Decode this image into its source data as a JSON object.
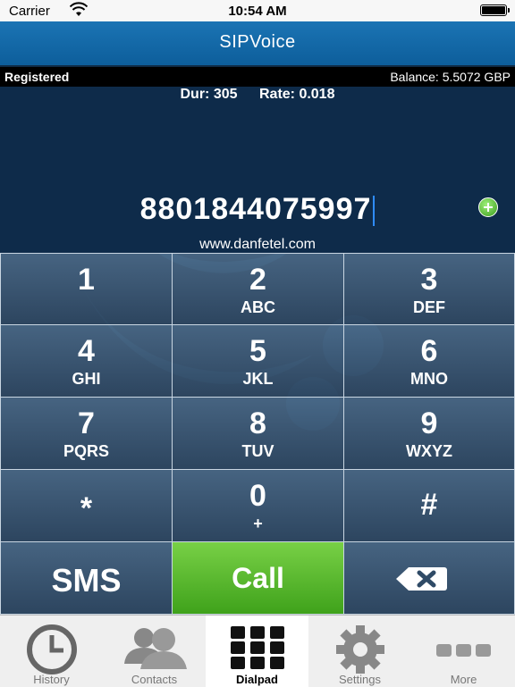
{
  "status_bar": {
    "carrier": "Carrier",
    "time": "10:54 AM"
  },
  "nav": {
    "title": "SIPVoice"
  },
  "info": {
    "registration": "Registered",
    "balance": "Balance: 5.5072 GBP"
  },
  "call_info": {
    "duration": "Dur: 305",
    "rate": "Rate: 0.018"
  },
  "dial": {
    "number": "8801844075997",
    "website": "www.danfetel.com"
  },
  "keys": [
    {
      "digit": "1",
      "letters": ""
    },
    {
      "digit": "2",
      "letters": "ABC"
    },
    {
      "digit": "3",
      "letters": "DEF"
    },
    {
      "digit": "4",
      "letters": "GHI"
    },
    {
      "digit": "5",
      "letters": "JKL"
    },
    {
      "digit": "6",
      "letters": "MNO"
    },
    {
      "digit": "7",
      "letters": "PQRS"
    },
    {
      "digit": "8",
      "letters": "TUV"
    },
    {
      "digit": "9",
      "letters": "WXYZ"
    },
    {
      "digit": "*",
      "letters": ""
    },
    {
      "digit": "0",
      "letters": "+"
    },
    {
      "digit": "#",
      "letters": ""
    }
  ],
  "actions": {
    "sms": "SMS",
    "call": "Call",
    "backspace_icon": "backspace-icon"
  },
  "tabs": [
    {
      "label": "History",
      "icon": "clock-icon"
    },
    {
      "label": "Contacts",
      "icon": "contacts-icon"
    },
    {
      "label": "Dialpad",
      "icon": "dialpad-icon",
      "active": true
    },
    {
      "label": "Settings",
      "icon": "gear-icon"
    },
    {
      "label": "More",
      "icon": "more-icon"
    }
  ],
  "colors": {
    "nav": "#1b74b4",
    "call": "#5bb92f",
    "keypad": "#3a5878",
    "display": "#0e2b4a"
  }
}
